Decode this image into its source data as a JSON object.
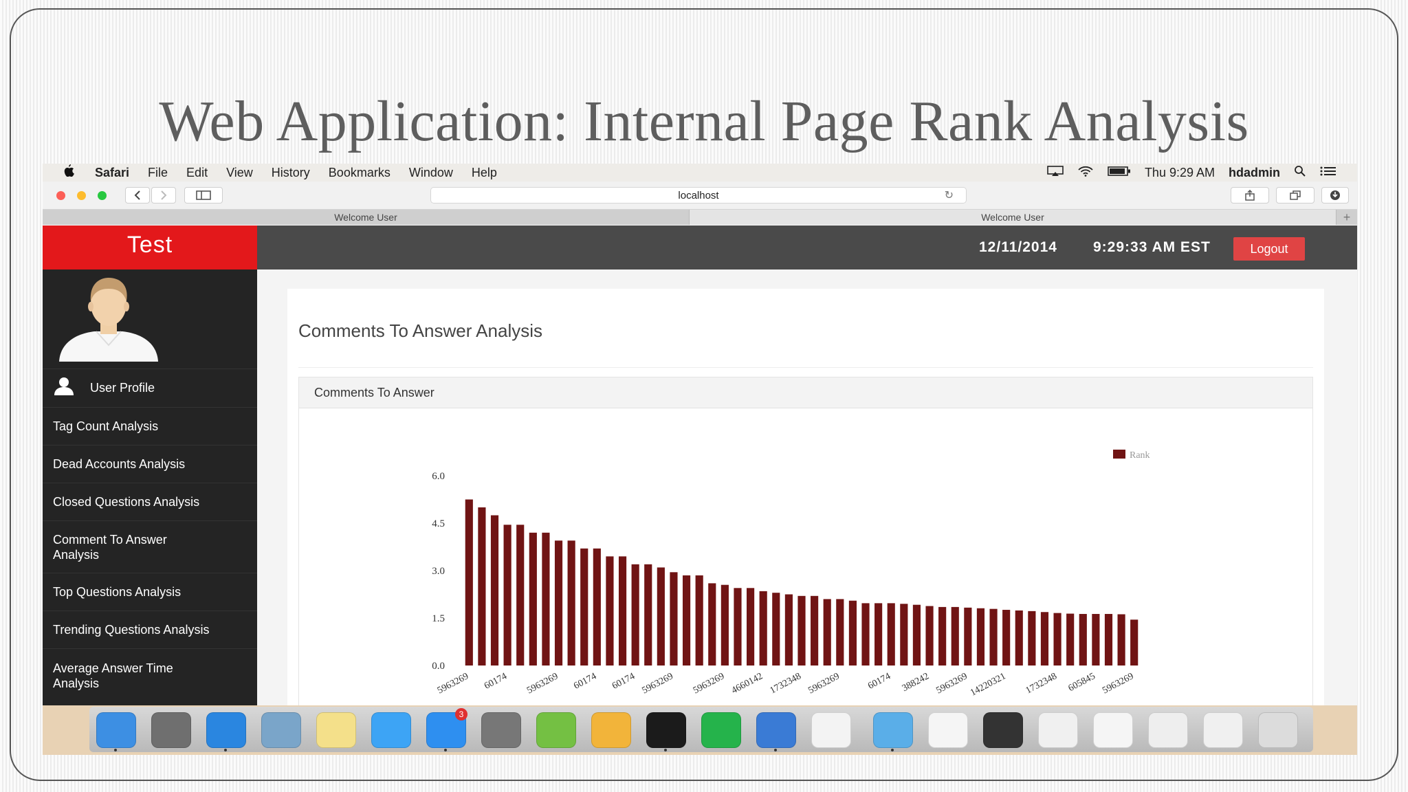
{
  "slide": {
    "title": "Web Application: Internal Page Rank Analysis"
  },
  "menubar": {
    "apple_icon": "apple-icon",
    "items": [
      "Safari",
      "File",
      "Edit",
      "View",
      "History",
      "Bookmarks",
      "Window",
      "Help"
    ],
    "clock": "Thu 9:29 AM",
    "user": "hdadmin"
  },
  "browser": {
    "url": "localhost",
    "tabs": [
      "Welcome User",
      "Welcome User"
    ]
  },
  "app": {
    "brand": "Test",
    "date": "12/11/2014",
    "time": "9:29:33 AM EST",
    "logout_label": "Logout",
    "sidebar": [
      "User Profile",
      "Tag Count Analysis",
      "Dead Accounts Analysis",
      "Closed Questions Analysis",
      "Comment To Answer Analysis",
      "Top Questions Analysis",
      "Trending Questions Analysis",
      "Average Answer Time Analysis"
    ],
    "page_title": "Comments To Answer Analysis",
    "card_title": "Comments To Answer"
  },
  "chart_data": {
    "type": "bar",
    "legend": "Rank",
    "legend_position": "top-right",
    "bar_color": "#701414",
    "ylim": [
      0,
      6.0
    ],
    "yticks": [
      "0.0",
      "1.5",
      "3.0",
      "4.5",
      "6.0"
    ],
    "x_labels": [
      "5963269",
      "60174",
      "5963269",
      "60174",
      "60174",
      "5963269",
      "5963269",
      "4660142",
      "1732348",
      "5963269",
      "60174",
      "388242",
      "5963269",
      "14220321",
      "1732348",
      "605845",
      "5963269"
    ],
    "values": [
      5.25,
      5.0,
      4.75,
      4.45,
      4.45,
      4.2,
      4.2,
      3.95,
      3.95,
      3.7,
      3.7,
      3.45,
      3.45,
      3.2,
      3.2,
      3.1,
      2.95,
      2.85,
      2.85,
      2.6,
      2.55,
      2.45,
      2.45,
      2.35,
      2.3,
      2.25,
      2.2,
      2.2,
      2.1,
      2.1,
      2.05,
      1.97,
      1.97,
      1.97,
      1.95,
      1.92,
      1.88,
      1.85,
      1.85,
      1.83,
      1.81,
      1.79,
      1.76,
      1.74,
      1.72,
      1.69,
      1.66,
      1.64,
      1.63,
      1.63,
      1.63,
      1.62,
      1.45
    ]
  },
  "dock": {
    "icons": [
      "finder-icon",
      "launchpad-icon",
      "safari-icon",
      "preview-icon",
      "notes-icon",
      "messages-icon",
      "app-store-icon",
      "system-preferences-icon",
      "spring-tool-icon",
      "weka-icon",
      "terminal-icon",
      "spotify-icon",
      "xcode-icon",
      "textedit-icon",
      "folder-icon",
      "window-thumbnail-icon",
      "window-thumbnail-icon",
      "window-thumbnail-icon",
      "window-thumbnail-icon",
      "window-thumbnail-icon",
      "window-thumbnail-icon",
      "trash-icon"
    ],
    "badge": "3"
  }
}
